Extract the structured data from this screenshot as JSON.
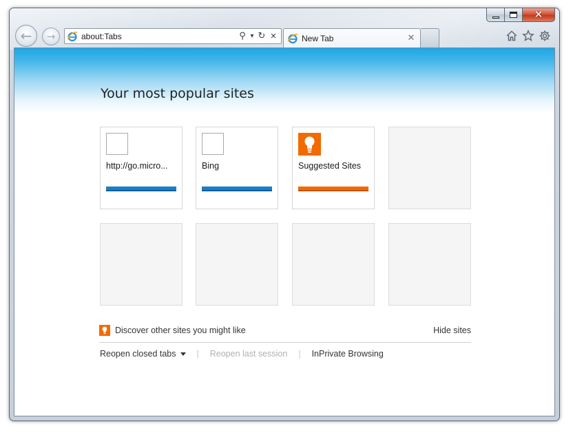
{
  "window": {
    "caption": {
      "minimize_icon": "minimize-icon",
      "maximize_icon": "maximize-icon",
      "close_icon": "close-icon",
      "close_glyph": "✕"
    }
  },
  "nav": {
    "back_icon": "back-arrow-icon",
    "forward_icon": "forward-arrow-icon",
    "back_glyph": "←",
    "forward_glyph": "→"
  },
  "address_bar": {
    "value": "about:Tabs",
    "favicon": "ie-logo-icon",
    "search_glyph": "⚲",
    "dropdown_glyph": "▾",
    "refresh_glyph": "↻",
    "stop_glyph": "✕"
  },
  "tabs": [
    {
      "label": "New Tab",
      "active": true,
      "favicon": "ie-logo-icon",
      "close_glyph": "✕"
    }
  ],
  "command_bar": {
    "home_icon": "home-icon",
    "favorites_icon": "star-icon",
    "tools_icon": "gear-icon"
  },
  "page": {
    "title": "Your most popular sites",
    "tiles": [
      {
        "label": "http://go.micro...",
        "icon": "blank-favicon",
        "bar_color": "#1a7fc4"
      },
      {
        "label": "Bing",
        "icon": "blank-favicon",
        "bar_color": "#1a7fc4"
      },
      {
        "label": "Suggested Sites",
        "icon": "lightbulb-icon",
        "bar_color": "#f26a00"
      },
      {
        "label": "",
        "icon": "",
        "bar_color": ""
      },
      {
        "label": "",
        "icon": "",
        "bar_color": ""
      },
      {
        "label": "",
        "icon": "",
        "bar_color": ""
      },
      {
        "label": "",
        "icon": "",
        "bar_color": ""
      },
      {
        "label": "",
        "icon": "",
        "bar_color": ""
      }
    ],
    "discover": {
      "text": "Discover other sites you might like",
      "hide": "Hide sites"
    },
    "actions": {
      "reopen_closed": "Reopen closed tabs",
      "reopen_last": "Reopen last session",
      "inprivate": "InPrivate Browsing",
      "separator": "|"
    }
  },
  "colors": {
    "accent_blue": "#1ea6e6",
    "tile_bar_blue": "#1a7fc4",
    "suggested_orange": "#f26a00",
    "close_button_red": "#c33b1d"
  }
}
